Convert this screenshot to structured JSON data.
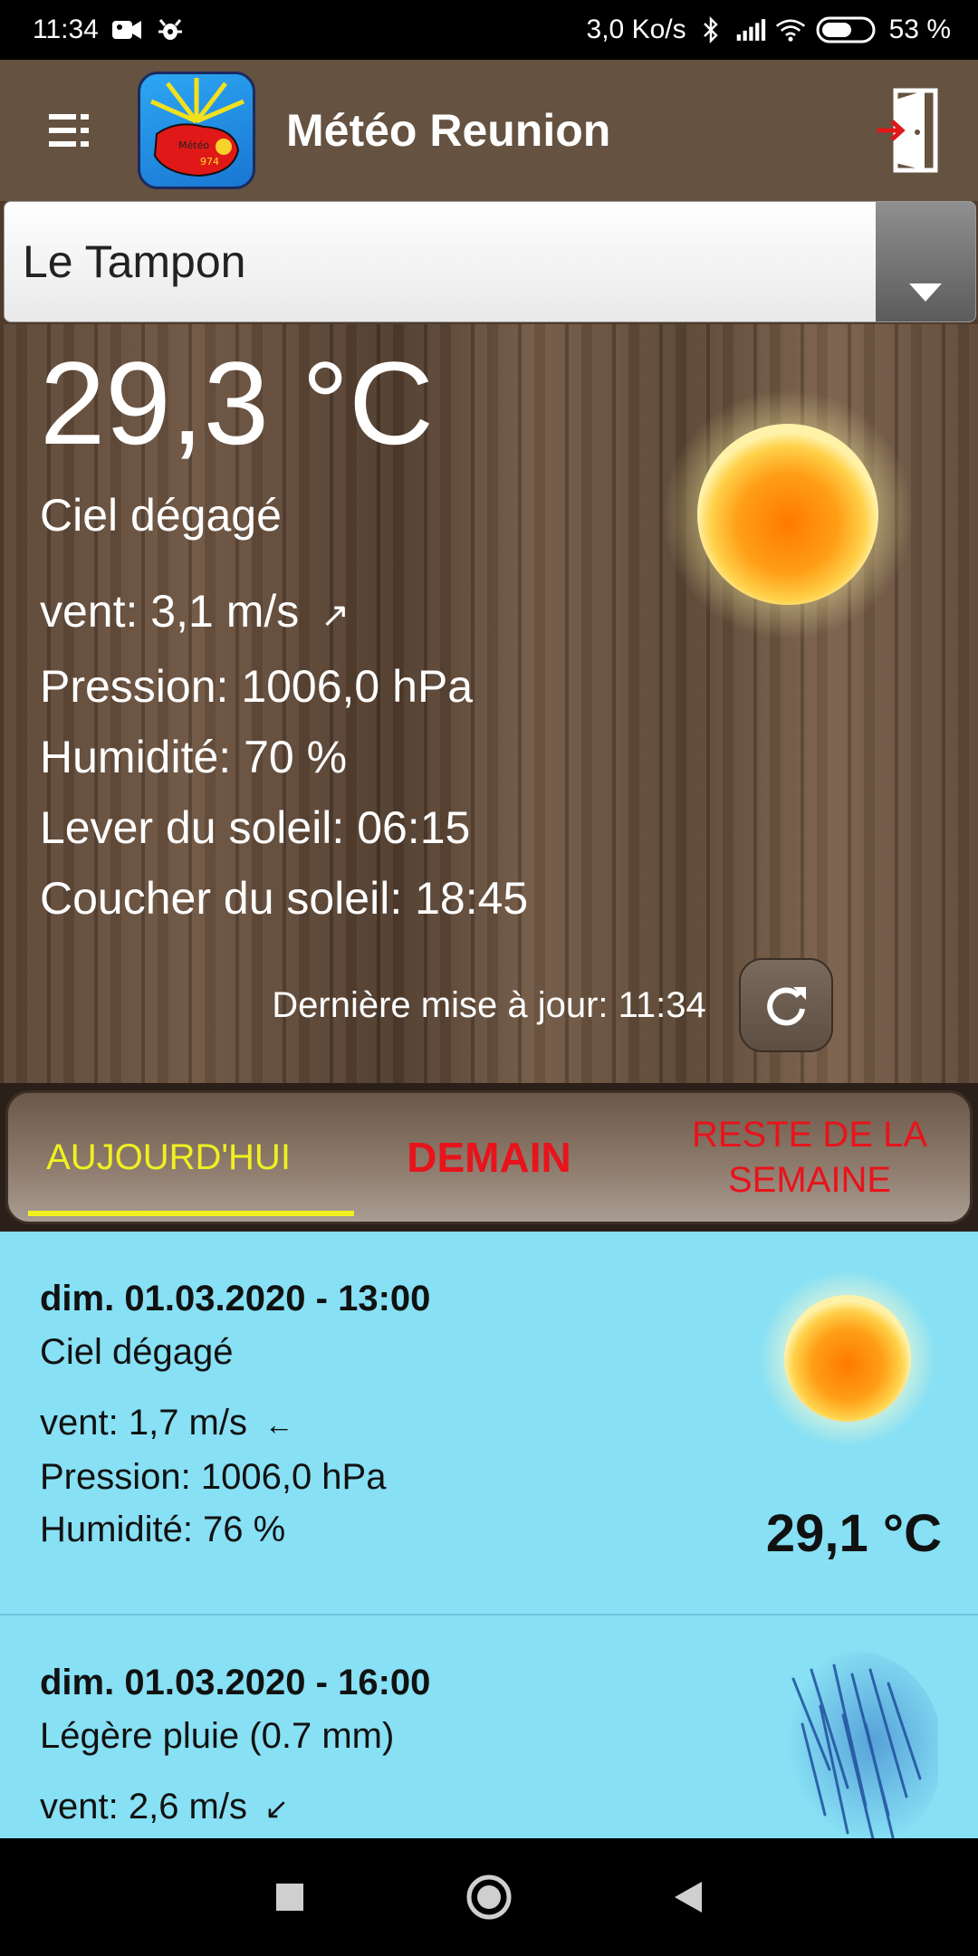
{
  "status_bar": {
    "time": "11:34",
    "network_speed": "3,0 Ko/s",
    "battery": "53 %"
  },
  "app_bar": {
    "title": "Météo Reunion",
    "logo_text_top": "Météo",
    "logo_text_bottom": "974"
  },
  "location": {
    "selected": "Le Tampon"
  },
  "current": {
    "temperature": "29,3 °C",
    "description": "Ciel dégagé",
    "wind": "vent: 3,1 m/s",
    "wind_arrow": "↗",
    "pressure": "Pression: 1006,0 hPa",
    "humidity": "Humidité: 70 %",
    "sunrise": "Lever du soleil: 06:15",
    "sunset": "Coucher du soleil: 18:45",
    "last_update": "Dernière mise à jour: 11:34",
    "icon": "sun-icon"
  },
  "tabs": {
    "today": "AUJOURD'HUI",
    "tomorrow": "DEMAIN",
    "week_line1": "RESTE DE LA",
    "week_line2": "SEMAINE"
  },
  "forecast": [
    {
      "datetime": "dim. 01.03.2020 - 13:00",
      "description": "Ciel dégagé",
      "wind": "vent: 1,7 m/s",
      "wind_arrow": "←",
      "pressure": "Pression: 1006,0 hPa",
      "humidity": "Humidité: 76 %",
      "temperature": "29,1 °C",
      "icon": "sun-icon"
    },
    {
      "datetime": "dim. 01.03.2020 - 16:00",
      "description": "Légère pluie (0.7 mm)",
      "wind": "vent: 2,6 m/s",
      "wind_arrow": "↙",
      "icon": "rain-icon"
    }
  ]
}
